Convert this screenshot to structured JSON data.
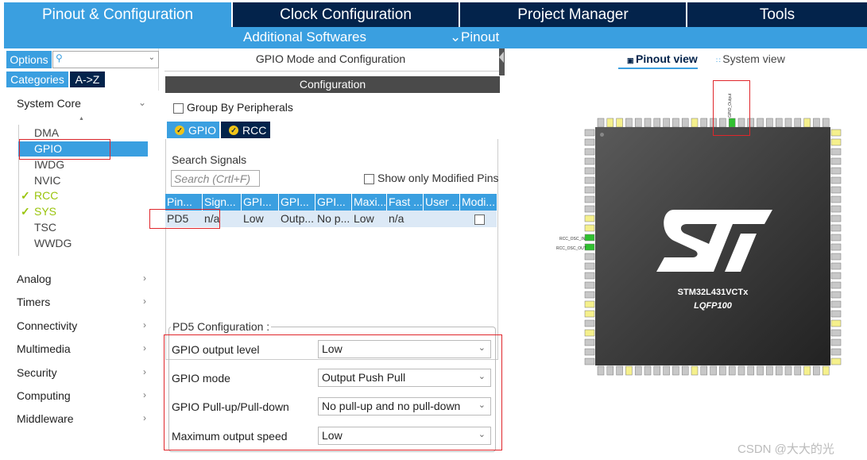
{
  "tabs": [
    {
      "label": "Pinout & Configuration",
      "active": true
    },
    {
      "label": "Clock Configuration"
    },
    {
      "label": "Project Manager"
    },
    {
      "label": "Tools"
    }
  ],
  "subbar": {
    "additional": "Additional Softwares",
    "pinout": "Pinout"
  },
  "left": {
    "options_label": "Options",
    "categories_label": "Categories",
    "az_label": "A->Z",
    "system_core": "System Core",
    "items": [
      {
        "label": "DMA"
      },
      {
        "label": "GPIO",
        "selected": true
      },
      {
        "label": "IWDG"
      },
      {
        "label": "NVIC"
      },
      {
        "label": "RCC",
        "checked": true
      },
      {
        "label": "SYS",
        "checked": true
      },
      {
        "label": "TSC"
      },
      {
        "label": "WWDG"
      }
    ],
    "categories": [
      "Analog",
      "Timers",
      "Connectivity",
      "Multimedia",
      "Security",
      "Computing",
      "Middleware"
    ]
  },
  "middle": {
    "title": "GPIO Mode and Configuration",
    "config_bar": "Configuration",
    "group_by": "Group By Peripherals",
    "periph_tabs": [
      "GPIO",
      "RCC"
    ],
    "search_label": "Search Signals",
    "search_placeholder": "Search (Crtl+F)",
    "modified_label": "Show only Modified Pins",
    "columns": [
      "Pin...",
      "Sign...",
      "GPI...",
      "GPI...",
      "GPI...",
      "Maxi...",
      "Fast ...",
      "User ...",
      "Modi..."
    ],
    "row": [
      "PD5",
      "n/a",
      "Low",
      "Outp...",
      "No p...",
      "Low",
      "n/a",
      "",
      ""
    ],
    "pd5_title": "PD5 Configuration :",
    "fields": [
      {
        "label": "GPIO output level",
        "value": "Low"
      },
      {
        "label": "GPIO mode",
        "value": "Output Push Pull"
      },
      {
        "label": "GPIO Pull-up/Pull-down",
        "value": "No pull-up and no pull-down"
      },
      {
        "label": "Maximum output speed",
        "value": "Low"
      }
    ]
  },
  "right": {
    "pinout_view": "Pinout view",
    "system_view": "System view",
    "chip_name": "STM32L431VCTx",
    "package": "LQFP100",
    "pin_labels": {
      "gpio_output": "GPIO_Output",
      "osc_in": "RCC_OSC_IN",
      "osc_out": "RCC_OSC_OUT"
    },
    "colors": {
      "pin_default": "#c8c8c8",
      "pin_power": "#f5f08c",
      "pin_green": "#30c030"
    }
  },
  "watermark": "CSDN @大大的光"
}
